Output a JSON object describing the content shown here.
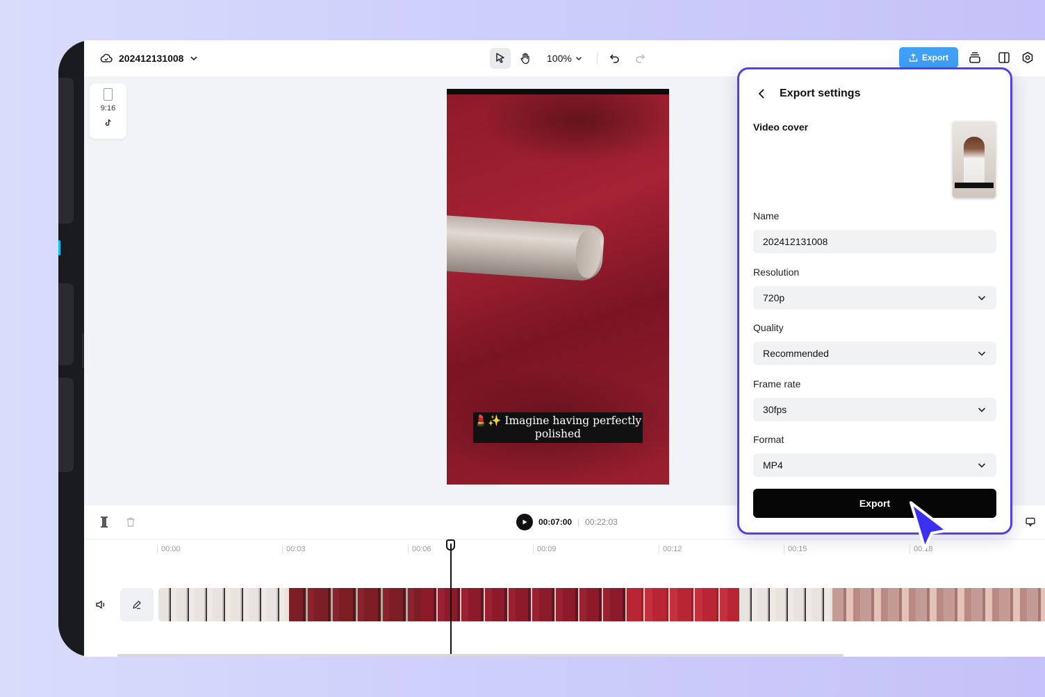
{
  "header": {
    "project_name": "202412131008",
    "zoom_level": "100%",
    "export_label": "Export"
  },
  "canvas": {
    "aspect_ratio": "9:16",
    "caption": "💄✨ Imagine having perfectly polished"
  },
  "playback": {
    "current_time": "00:07:00",
    "total_time": "00:22:03"
  },
  "timeline": {
    "ticks": [
      "00:00",
      "00:03",
      "00:06",
      "00:09",
      "00:12",
      "00:15",
      "00:18"
    ]
  },
  "export_panel": {
    "title": "Export settings",
    "cover_label": "Video cover",
    "name_label": "Name",
    "name_value": "202412131008",
    "resolution_label": "Resolution",
    "resolution_value": "720p",
    "quality_label": "Quality",
    "quality_value": "Recommended",
    "framerate_label": "Frame rate",
    "framerate_value": "30fps",
    "format_label": "Format",
    "format_value": "MP4",
    "export_button": "Export"
  },
  "colors": {
    "accent_blue": "#3fa0f5",
    "panel_border": "#4f3ff0",
    "cursor": "#3b2ff0"
  }
}
